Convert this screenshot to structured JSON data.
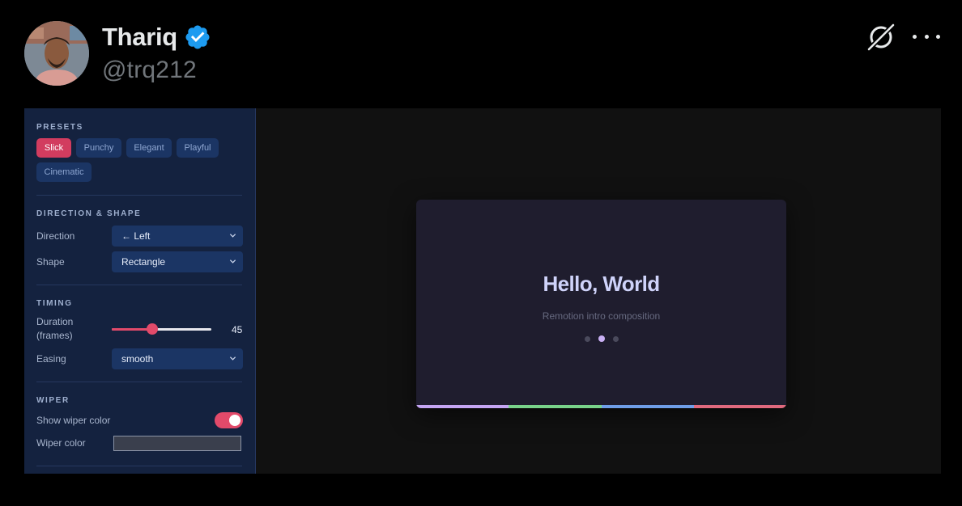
{
  "tweet": {
    "author_name": "Thariq",
    "author_handle": "@trq212",
    "verified_color": "#1d9bf0"
  },
  "panel": {
    "presets": {
      "title": "PRESETS",
      "items": [
        {
          "label": "Slick",
          "active": true
        },
        {
          "label": "Punchy",
          "active": false
        },
        {
          "label": "Elegant",
          "active": false
        },
        {
          "label": "Playful",
          "active": false
        },
        {
          "label": "Cinematic",
          "active": false
        }
      ]
    },
    "direction_shape": {
      "title": "DIRECTION & SHAPE",
      "direction_label": "Direction",
      "direction_value": "← Left",
      "shape_label": "Shape",
      "shape_value": "Rectangle"
    },
    "timing": {
      "title": "TIMING",
      "duration_label_line1": "Duration",
      "duration_label_line2": "(frames)",
      "duration_value": "45",
      "duration_fraction": 0.41,
      "easing_label": "Easing",
      "easing_value": "smooth"
    },
    "wiper": {
      "title": "WIPER",
      "show_color_label": "Show wiper color",
      "show_color_on": true,
      "color_label": "Wiper color"
    }
  },
  "preview": {
    "title": "Hello, World",
    "subtitle": "Remotion intro composition",
    "active_dot": 1,
    "bar_colors": [
      "#c4a5f3",
      "#79d38a",
      "#6f9ee8",
      "#e0697e"
    ]
  },
  "colors": {
    "accent": "#d23c5f",
    "panel_bg": "#14223f",
    "chip_bg": "#1b3564"
  }
}
